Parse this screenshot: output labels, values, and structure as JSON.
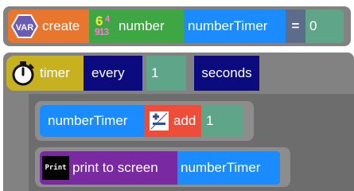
{
  "create_block": {
    "var_icon": "VAR",
    "create_label": "create",
    "number_icon_digits": {
      "top": "6",
      "top_small": "4",
      "bottom": "913"
    },
    "number_label": "number",
    "var_name": "numberTimer",
    "equals": "=",
    "value": "0"
  },
  "timer_block": {
    "icon": "stopwatch-icon",
    "timer_label": "timer",
    "every_label": "every",
    "interval": "1",
    "unit_label": "seconds"
  },
  "add_block": {
    "var_name": "numberTimer",
    "add_icon": "plus-minus-icon",
    "add_label": "add",
    "amount": "1"
  },
  "print_block": {
    "print_icon": "Print",
    "print_label": "print to screen",
    "var_name": "numberTimer"
  },
  "colors": {
    "create": "#e8762f",
    "number": "#3ea642",
    "variable": "#1a8cff",
    "timer": "#c8b11f",
    "every": "#0b0b7f",
    "add": "#ee4d3a",
    "print": "#7a2aa0",
    "value": "#5fa58a"
  }
}
